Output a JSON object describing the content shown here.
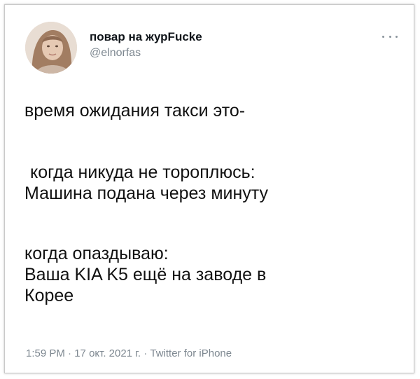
{
  "tweet": {
    "author_name": "повар на журFucke",
    "author_handle": "@elnorfas",
    "lines": [
      "время ожидания такси это-",
      "когда никуда не тороплюсь:",
      "Машина подана через минуту",
      "когда опаздываю:",
      "Ваша KIA K5 ещё на заводе в",
      "Корее"
    ],
    "time": "1:59 PM",
    "date": "17 окт. 2021 г.",
    "source": "Twitter for iPhone",
    "separator": "·"
  },
  "icons": {
    "more": "more-options-icon",
    "avatar": "profile-photo"
  },
  "colors": {
    "text": "#0f1419",
    "secondary": "#7d8790"
  }
}
